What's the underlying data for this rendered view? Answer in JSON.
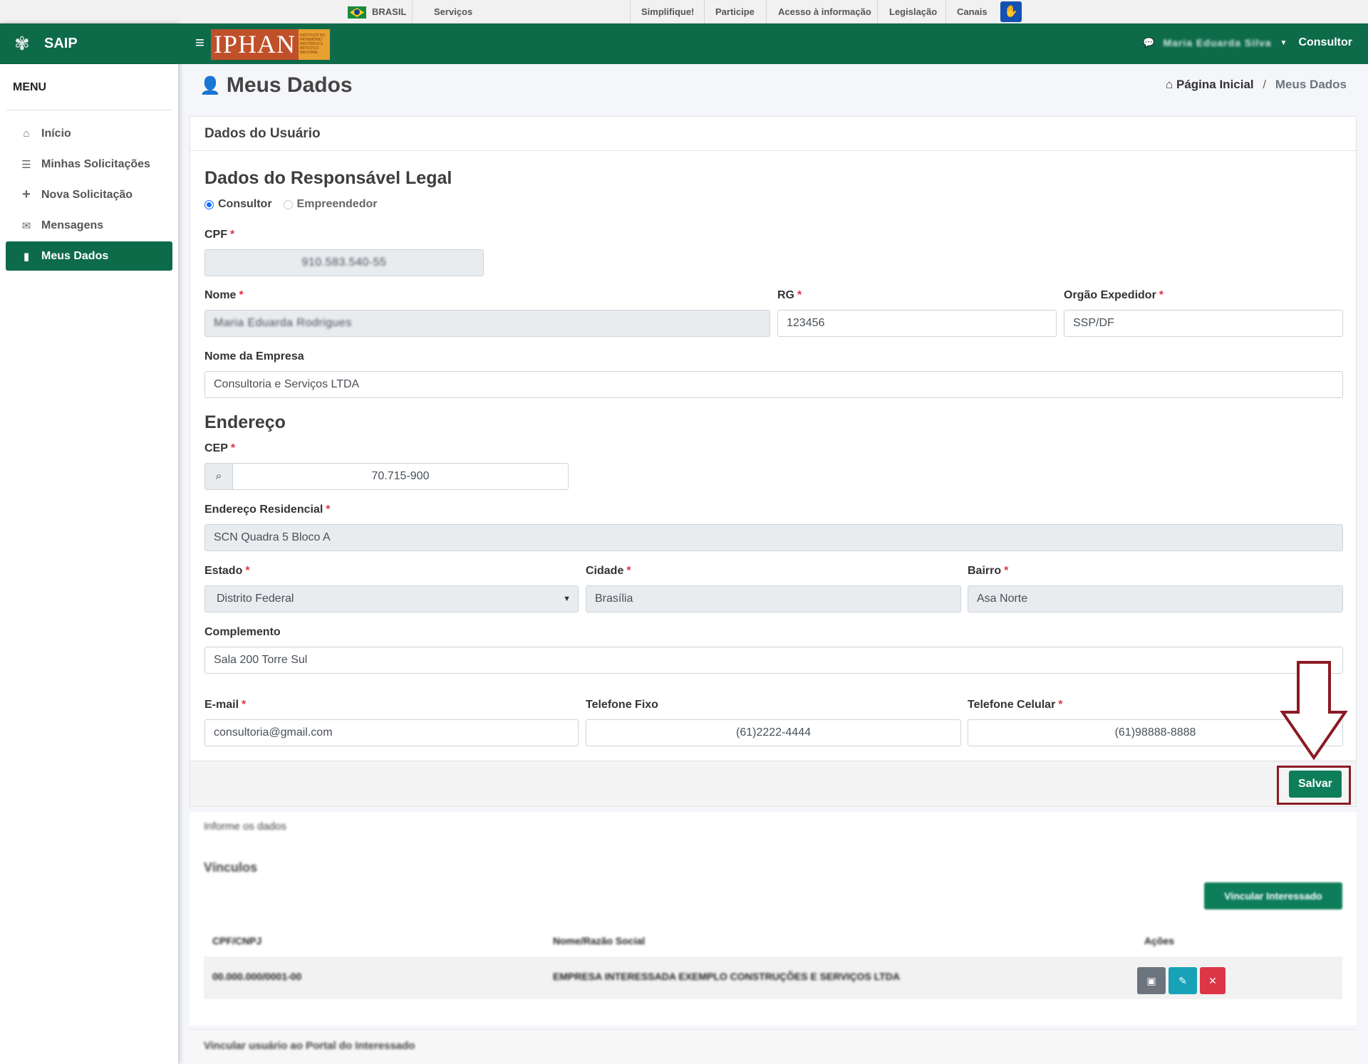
{
  "govbar": {
    "country": "BRASIL",
    "services": "Serviços",
    "links": [
      "Simplifique!",
      "Participe",
      "Acesso à informação",
      "Legislação",
      "Canais"
    ]
  },
  "brand": {
    "name": "SAIP"
  },
  "header": {
    "logo_text": "IPHAN",
    "logo_sub": "INSTITUTO DO PATRIMÔNIO HISTÓRICO E ARTÍSTICO NACIONAL",
    "user_name": "Maria Eduarda Silva",
    "role": "Consultor"
  },
  "sidebar": {
    "menu_title": "MENU",
    "items": [
      {
        "label": "Início",
        "icon": "home-icon"
      },
      {
        "label": "Minhas Solicitações",
        "icon": "list-icon"
      },
      {
        "label": "Nova Solicitação",
        "icon": "plus-icon"
      },
      {
        "label": "Mensagens",
        "icon": "comments-icon"
      },
      {
        "label": "Meus Dados",
        "icon": "file-icon",
        "active": true
      }
    ]
  },
  "page": {
    "title": "Meus Dados",
    "breadcrumb": {
      "home": "Página Inicial",
      "current": "Meus Dados"
    }
  },
  "card": {
    "header": "Dados do Usuário",
    "section_legal": "Dados do Responsável Legal",
    "radio_consultor": "Consultor",
    "radio_empreendedor": "Empreendedor",
    "section_address": "Endereço",
    "save_label": "Salvar"
  },
  "fields": {
    "cpf": {
      "label": "CPF",
      "value": "910.583.540-55"
    },
    "nome": {
      "label": "Nome",
      "value": "Maria Eduarda Rodrigues"
    },
    "rg": {
      "label": "RG",
      "value": "123456"
    },
    "orgao": {
      "label": "Orgão Expedidor",
      "value": "SSP/DF"
    },
    "empresa": {
      "label": "Nome da Empresa",
      "value": "Consultoria e Serviços LTDA"
    },
    "cep": {
      "label": "CEP",
      "value": "70.715-900"
    },
    "endereco": {
      "label": "Endereço Residencial",
      "value": "SCN Quadra 5 Bloco A"
    },
    "estado": {
      "label": "Estado",
      "value": "Distrito Federal"
    },
    "cidade": {
      "label": "Cidade",
      "value": "Brasília"
    },
    "bairro": {
      "label": "Bairro",
      "value": "Asa Norte"
    },
    "complemento": {
      "label": "Complemento",
      "value": "Sala 200 Torre Sul"
    },
    "email": {
      "label": "E-mail",
      "value": "consultoria@gmail.com"
    },
    "fixo": {
      "label": "Telefone Fixo",
      "value": "(61)2222-4444"
    },
    "celular": {
      "label": "Telefone Celular",
      "value": "(61)98888-8888"
    }
  },
  "lower": {
    "note": "Informe os dados",
    "vinculos_title": "Vínculos",
    "add_button": "Vincular Interessado",
    "columns": [
      "CPF/CNPJ",
      "Nome/Razão Social",
      "Ações"
    ],
    "rows": [
      {
        "doc": "00.000.000/0001-00",
        "name": "EMPRESA INTERESSADA EXEMPLO CONSTRUÇÕES E SERVIÇOS LTDA"
      }
    ],
    "footer_text": "Vincular usuário ao Portal do Interessado"
  },
  "colors": {
    "primary": "#0d6b4a",
    "button": "#0e7d5a",
    "highlight": "#8b1a24"
  }
}
